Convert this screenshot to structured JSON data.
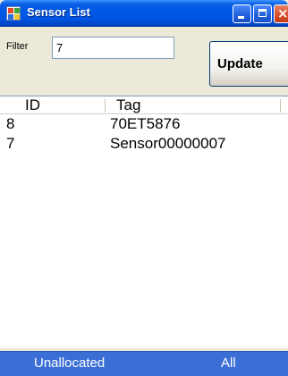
{
  "window": {
    "title": "Sensor List",
    "icon": "sensor-list-app-icon"
  },
  "titlebar_buttons": {
    "minimize_icon": "minimize-icon",
    "maximize_icon": "maximize-icon",
    "close_icon": "close-icon",
    "close_glyph": "×"
  },
  "filter": {
    "label": "Filter",
    "value": "7"
  },
  "toolbar": {
    "update_label": "Update"
  },
  "list": {
    "columns": [
      "ID",
      "Tag"
    ],
    "rows": [
      {
        "id": "8",
        "tag": "70ET5876"
      },
      {
        "id": "7",
        "tag": "Sensor00000007"
      }
    ]
  },
  "status": {
    "left": "Unallocated",
    "right": "All"
  }
}
